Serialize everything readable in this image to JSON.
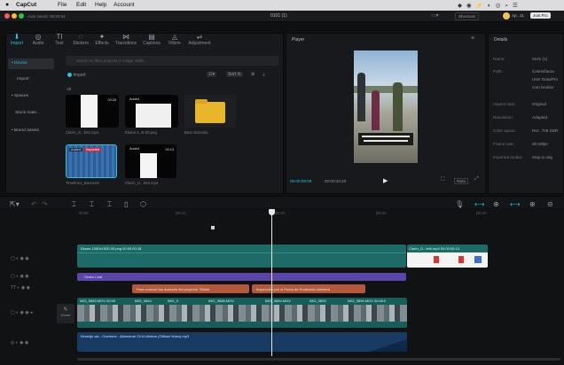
{
  "menubar": {
    "apple_icon": "apple-icon",
    "app": "CapCut",
    "items": [
      "File",
      "Edit",
      "Help",
      "Account"
    ]
  },
  "titlebar": {
    "left_text": "Auto saved: 08:20:54",
    "project_name": "0101 (1)",
    "shortcuts_label": "Shortcuts",
    "user_label": "Ap...11",
    "join_label": "Join Pro"
  },
  "tabs": [
    {
      "label": "Import",
      "icon": "import-icon",
      "glyph": "⬇"
    },
    {
      "label": "Audio",
      "icon": "audio-icon",
      "glyph": "◎"
    },
    {
      "label": "Text",
      "icon": "text-icon",
      "glyph": "TI"
    },
    {
      "label": "Stickers",
      "icon": "stickers-icon",
      "glyph": "◌"
    },
    {
      "label": "Effects",
      "icon": "effects-icon",
      "glyph": "✦"
    },
    {
      "label": "Transitions",
      "icon": "transitions-icon",
      "glyph": "⋈"
    },
    {
      "label": "Captions",
      "icon": "captions-icon",
      "glyph": "▤"
    },
    {
      "label": "Filters",
      "icon": "filters-icon",
      "glyph": "◬"
    },
    {
      "label": "Adjustment",
      "icon": "adjustment-icon",
      "glyph": "⇌"
    }
  ],
  "sidebar": [
    {
      "label": "• Device"
    },
    {
      "label": "Import"
    },
    {
      "label": "• Spaces"
    },
    {
      "label": "Stock mate..."
    },
    {
      "label": "• Brand assets"
    }
  ],
  "media": {
    "search_placeholder": "Search for files, projects or image, video",
    "import_label": "Import",
    "all_label": "All",
    "sort_label": "Sort",
    "items": [
      {
        "label": "Clarín_G...fetti.mp4",
        "added": "",
        "duration": "00:28"
      },
      {
        "label": "Ekane-1..B-00.png",
        "added": "Added",
        "duration": ""
      },
      {
        "label": "Best Abriendo",
        "added": "",
        "duration": ""
      },
      {
        "label": "Timeline1_Bounce5",
        "added": "Added",
        "duration": "Imported"
      },
      {
        "label": "Clarín_G...fetti.mp4",
        "added": "Added",
        "duration": "00:13"
      }
    ]
  },
  "player": {
    "title": "Player",
    "current_time": "00:00:09:09",
    "total_time": "00:00:40:20",
    "ratio_label": "Ratio",
    "menu_icon": "menu-icon"
  },
  "details": {
    "title": "Details",
    "rows": [
      {
        "k": "Name:",
        "v": "0101 (1)"
      },
      {
        "k": "Path:",
        "v": "/Users/laura"
      },
      {
        "k": "",
        "v": "User Data/Pro"
      },
      {
        "k": "",
        "v": "com.lveditor"
      },
      {
        "k": "Aspect ratio:",
        "v": "Original"
      },
      {
        "k": "Resolution:",
        "v": "Adapted"
      },
      {
        "k": "Color space:",
        "v": "Rec. 709 SDR"
      },
      {
        "k": "Frame rate:",
        "v": "30.00fps"
      },
      {
        "k": "Imported media:",
        "v": "Stay in orig"
      }
    ]
  },
  "timeline": {
    "ruler": [
      "00:00",
      "|00:10",
      "|00:20",
      "|00:30",
      "|00:40"
    ],
    "cover_label": "Cover",
    "clips": {
      "sticker": "Ekane-1080x1920-00.png 00:00:00:18",
      "sticker2": "Clarín_G...fetti.mp4 00:00:00:13",
      "green": "Green Leaf",
      "text1": "Para conocer los avances del proyecto \"Eliseb",
      "text2": "Inspección por el Punto de Protección Ambient",
      "video_labels": [
        "IMG_9689.MOV  00:00",
        "IMG_9663",
        "IMG_9",
        "IMG_9688.MOV",
        "IMG_9684.MOV",
        "IMG_9690",
        "IMG_9696.MOV  00:00:0"
      ],
      "audio": "Kimedje.aiz - Overtone - Adventure Of A Lifetime (Official Video).mp3"
    }
  }
}
